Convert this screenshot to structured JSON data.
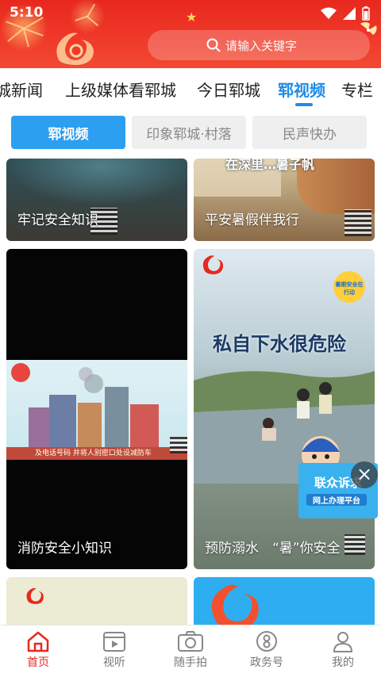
{
  "status_bar": {
    "time": "5:10"
  },
  "search": {
    "placeholder": "请输入关键字"
  },
  "channels": {
    "items": [
      "城新闻",
      "上级媒体看郓城",
      "今日郓城",
      "郓视频",
      "专栏"
    ],
    "active": "郓视频"
  },
  "subtabs": {
    "items": [
      "郓视频",
      "印象郓城·村落",
      "民声快办"
    ],
    "active": "郓视频"
  },
  "cards": [
    {
      "caption": "牢记安全知识"
    },
    {
      "caption": "平安暑假伴我行",
      "overlay_text": "在深里…暑子帆"
    },
    {
      "caption": "消防安全小知识",
      "overlay_text": "及电话号码 并将人别密口处设减防车"
    },
    {
      "caption": "预防溺水　“暑”你安全",
      "overlay_text": "私自下水很危险",
      "badge_text": "暑期安全在行动"
    }
  ],
  "float_ad": {
    "title": "联众诉求",
    "subtitle": "网上办理平台"
  },
  "bottom_nav": {
    "items": [
      "首页",
      "视听",
      "随手拍",
      "政务号",
      "我的"
    ],
    "active": "首页"
  },
  "colors": {
    "brand_red": "#e8281e",
    "accent_blue": "#1e8be6",
    "subtab_blue": "#2d9ff0"
  }
}
